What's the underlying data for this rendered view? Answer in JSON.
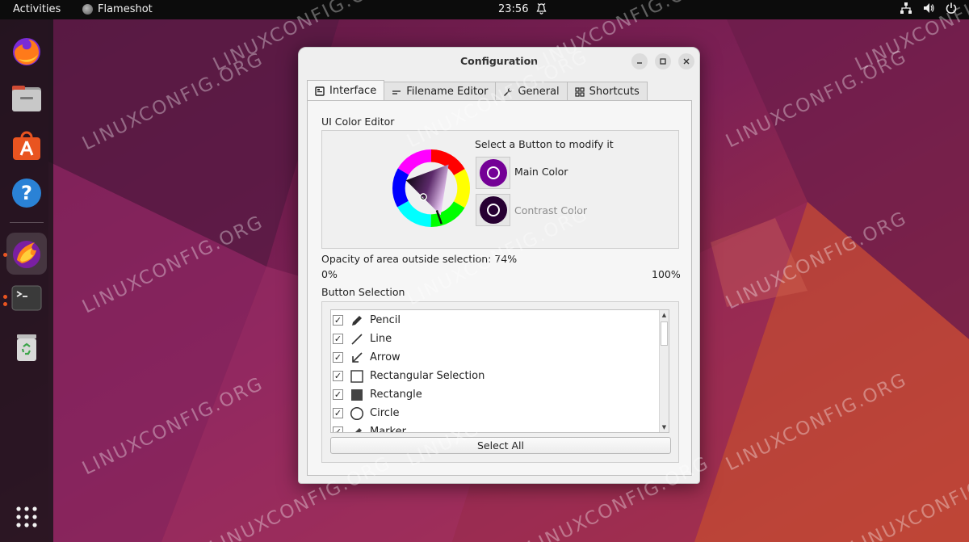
{
  "topbar": {
    "activities": "Activities",
    "app_name": "Flameshot",
    "clock": "23:56",
    "app_icon": "flameshot-icon",
    "tray_icons": [
      "network-icon",
      "volume-icon",
      "power-icon"
    ]
  },
  "dock": {
    "items": [
      {
        "name": "firefox",
        "icon": "firefox-icon"
      },
      {
        "name": "files",
        "icon": "folder-icon"
      },
      {
        "name": "software",
        "icon": "app-store-icon"
      },
      {
        "name": "help",
        "icon": "help-icon"
      },
      {
        "name": "flameshot",
        "icon": "flameshot-icon",
        "active": true
      },
      {
        "name": "terminal",
        "icon": "terminal-icon"
      },
      {
        "name": "trash",
        "icon": "trash-icon"
      }
    ],
    "show_apps_icon": "grid-icon"
  },
  "window": {
    "title": "Configuration",
    "tabs": [
      {
        "label": "Interface",
        "icon": "interface-icon",
        "active": true
      },
      {
        "label": "Filename Editor",
        "icon": "text-icon"
      },
      {
        "label": "General",
        "icon": "wrench-icon"
      },
      {
        "label": "Shortcuts",
        "icon": "grid-icon"
      }
    ],
    "ui_color_editor": {
      "heading": "UI Color Editor",
      "hint": "Select a Button to modify it",
      "main_color_label": "Main Color",
      "contrast_color_label": "Contrast Color",
      "main_color": "#740096",
      "contrast_color": "#270032"
    },
    "opacity": {
      "label": "Opacity of area outside selection: 74%",
      "min_label": "0%",
      "max_label": "100%",
      "value": 74
    },
    "button_selection": {
      "heading": "Button Selection",
      "items": [
        {
          "label": "Pencil",
          "icon": "pencil-icon",
          "checked": true
        },
        {
          "label": "Line",
          "icon": "line-icon",
          "checked": true
        },
        {
          "label": "Arrow",
          "icon": "arrow-icon",
          "checked": true
        },
        {
          "label": "Rectangular Selection",
          "icon": "rect-selection-icon",
          "checked": true
        },
        {
          "label": "Rectangle",
          "icon": "filled-rect-icon",
          "checked": true
        },
        {
          "label": "Circle",
          "icon": "circle-icon",
          "checked": true
        },
        {
          "label": "Marker",
          "icon": "marker-icon",
          "checked": true
        }
      ],
      "select_all": "Select All"
    }
  },
  "watermark": "LINUXCONFIG.ORG",
  "colors": {
    "accent": "#3d8ee6",
    "ubuntu_orange": "#e95420"
  }
}
